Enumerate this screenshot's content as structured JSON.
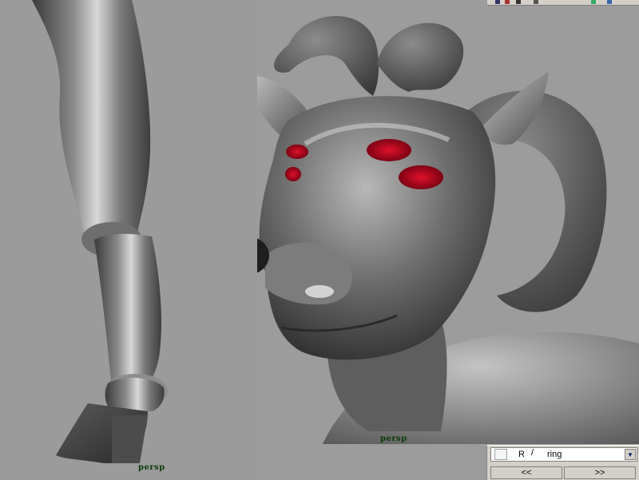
{
  "viewports": {
    "left": {
      "camera_label": "persp"
    },
    "right": {
      "camera_label": "persp"
    }
  },
  "channel_box": {
    "cell_r": "R",
    "cell_slash": "/",
    "cell_name": "ring",
    "dropdown_icon": "chevron-down-icon",
    "prev_label": "<<",
    "next_label": ">>"
  },
  "colors": {
    "viewport_bg": "#9b9b9b",
    "camera_label": "#0a3a0a",
    "eye_red": "#c0001a",
    "panel_bg": "#d4d0c8"
  }
}
